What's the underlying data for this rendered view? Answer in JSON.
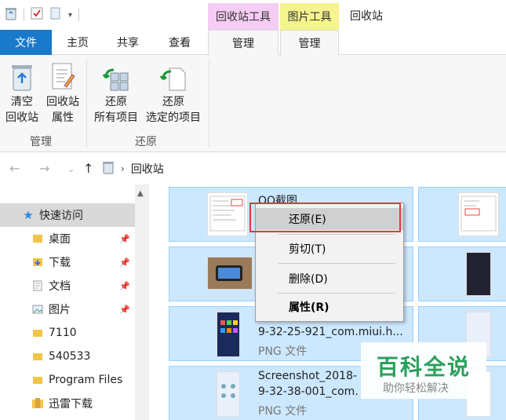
{
  "window": {
    "title": "回收站",
    "context_tabs": {
      "recycle_tools": "回收站工具",
      "picture_tools": "图片工具"
    }
  },
  "tabs": {
    "file": "文件",
    "home": "主页",
    "share": "共享",
    "view": "查看",
    "manage_recycle": "管理",
    "manage_picture": "管理"
  },
  "ribbon": {
    "empty_line1": "清空",
    "empty_line2": "回收站",
    "props_line1": "回收站",
    "props_line2": "属性",
    "restore_all_line1": "还原",
    "restore_all_line2": "所有项目",
    "restore_sel_line1": "还原",
    "restore_sel_line2": "选定的项目",
    "group_manage": "管理",
    "group_restore": "还原"
  },
  "address": {
    "path": "回收站"
  },
  "nav": {
    "quick_access": "快速访问",
    "items": [
      {
        "label": "桌面",
        "pinned": true
      },
      {
        "label": "下载",
        "pinned": true
      },
      {
        "label": "文档",
        "pinned": true
      },
      {
        "label": "图片",
        "pinned": true
      },
      {
        "label": "7110",
        "pinned": false
      },
      {
        "label": "540533",
        "pinned": false
      },
      {
        "label": "Program Files",
        "pinned": false
      },
      {
        "label": "迅雷下载",
        "pinned": false
      }
    ]
  },
  "files": [
    {
      "name": "QQ截图",
      "type": ""
    },
    {
      "name": "9-32-25-921_com.miui.h...",
      "type": "PNG 文件"
    },
    {
      "name": "Screenshot_2018-",
      "name2": "9-32-38-001_com.",
      "type": "PNG 文件"
    }
  ],
  "context_menu": {
    "restore": "还原(E)",
    "cut": "剪切(T)",
    "delete": "删除(D)",
    "properties": "属性(R)"
  },
  "watermark": {
    "big": "百科全说",
    "small": "助你轻松解决"
  },
  "colors": {
    "file_tab": "#1979ca",
    "selection": "#cce8ff",
    "highlight": "#e03a3a",
    "recycle_ctx": "#f5ccf3",
    "picture_ctx": "#f5f48d"
  }
}
